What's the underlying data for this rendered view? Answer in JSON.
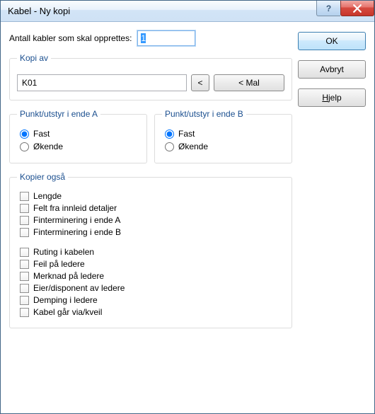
{
  "title": "Kabel - Ny kopi",
  "count_label": "Antall kabler som skal opprettes:",
  "count_value": "1",
  "kopi_av": {
    "legend": "Kopi av",
    "value": "K01",
    "prev_button": "<",
    "mal_button": "< Mal"
  },
  "ende_a": {
    "legend": "Punkt/utstyr i ende A",
    "fast": "Fast",
    "okende": "Økende",
    "selected": "fast"
  },
  "ende_b": {
    "legend": "Punkt/utstyr i ende B",
    "fast": "Fast",
    "okende": "Økende",
    "selected": "fast"
  },
  "kopier_legend": "Kopier også",
  "opts": {
    "lengde": "Lengde",
    "felt": "Felt fra innleid detaljer",
    "fint_a": "Finterminering i ende A",
    "fint_b": "Finterminering i ende B",
    "ruting": "Ruting i kabelen",
    "feil": "Feil på ledere",
    "merknad": "Merknad på ledere",
    "eier": "Eier/disponent av ledere",
    "demping": "Demping i ledere",
    "via": "Kabel går via/kveil"
  },
  "buttons": {
    "ok": "OK",
    "avbryt": "Avbryt",
    "hjelp": "Hjelp",
    "hjelp_prefix": "H",
    "hjelp_suffix": "jelp"
  }
}
